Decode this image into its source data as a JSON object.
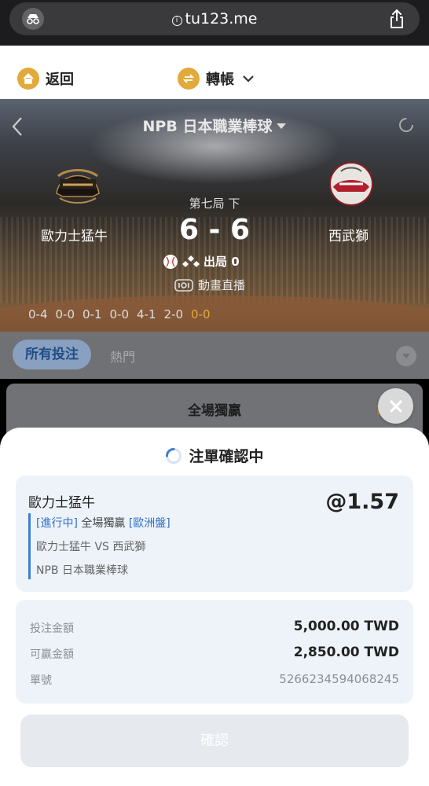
{
  "browser": {
    "url": "tu123.me"
  },
  "topnav": {
    "back_label": "返回",
    "transfer_label": "轉帳"
  },
  "match": {
    "league": "NPB 日本職業棒球",
    "inning": "第七局 下",
    "score": "6 - 6",
    "home_team": "歐力士猛牛",
    "away_team": "西武獅",
    "outs_label": "出局 0",
    "live_label": "動畫直播",
    "innings": [
      "0-4",
      "0-0",
      "0-1",
      "0-0",
      "4-1",
      "2-0",
      "0-0"
    ]
  },
  "tabs": {
    "all": "所有投注",
    "hot": "熱門"
  },
  "market": {
    "title": "全場獨贏",
    "badge": "可"
  },
  "sheet": {
    "title": "注單確認中",
    "bet": {
      "selection": "歐力士猛牛",
      "odds": "@1.57",
      "status": "[進行中]",
      "market": "全場獨贏",
      "handicap": "[歐洲盤]",
      "matchup": "歐力士猛牛 VS 西武獅",
      "league": "NPB 日本職業棒球"
    },
    "stake_label": "投注金額",
    "stake_value": "5,000.00 TWD",
    "win_label": "可贏金額",
    "win_value": "2,850.00 TWD",
    "ticket_label": "單號",
    "ticket_value": "5266234594068245",
    "confirm_label": "確認"
  },
  "colors": {
    "accent_gold": "#e2a93b",
    "accent_blue": "#2f6fc5"
  }
}
